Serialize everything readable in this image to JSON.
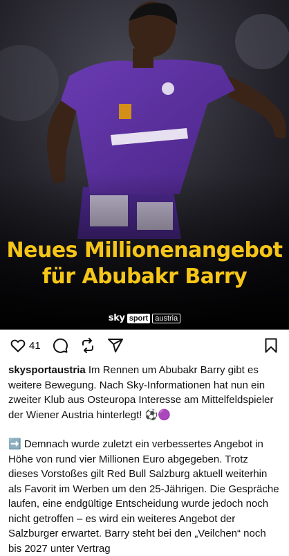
{
  "post": {
    "headline_line1": "Neues Millionenangebot",
    "headline_line2": "für Abubakr Barry",
    "brand": {
      "sky": "sky",
      "sport": "sport",
      "country": "austria"
    },
    "colors": {
      "headline": "#f5c518",
      "kit_purple": "#5a2f9e"
    },
    "photo_description": "player-in-purple-kit"
  },
  "actions": {
    "like_count": "41",
    "icons": [
      "heart-icon",
      "comment-icon",
      "repost-icon",
      "share-icon",
      "bookmark-icon"
    ]
  },
  "caption": {
    "username": "skysportaustria",
    "paragraph1": " Im Rennen um Abubakr Barry gibt es weitere Bewegung. Nach Sky-Informationen hat nun ein zweiter Klub aus Osteuropa Interesse am Mittelfeldspieler der Wiener Austria hinterlegt! ⚽🟣",
    "paragraph2": "➡️ Demnach wurde zuletzt ein verbessertes Angebot in Höhe von rund vier Millionen Euro abgegeben. Trotz dieses Vorstoßes gilt Red Bull Salzburg aktuell weiterhin als Favorit im Werben um den 25-Jährigen. Die Gespräche laufen, eine endgültige Entscheidung wurde jedoch noch nicht getroffen – es wird ein weiteres Angebot der Salzburger erwartet. Barry steht bei den „Veilchen“ noch bis 2027 unter Vertrag"
  }
}
